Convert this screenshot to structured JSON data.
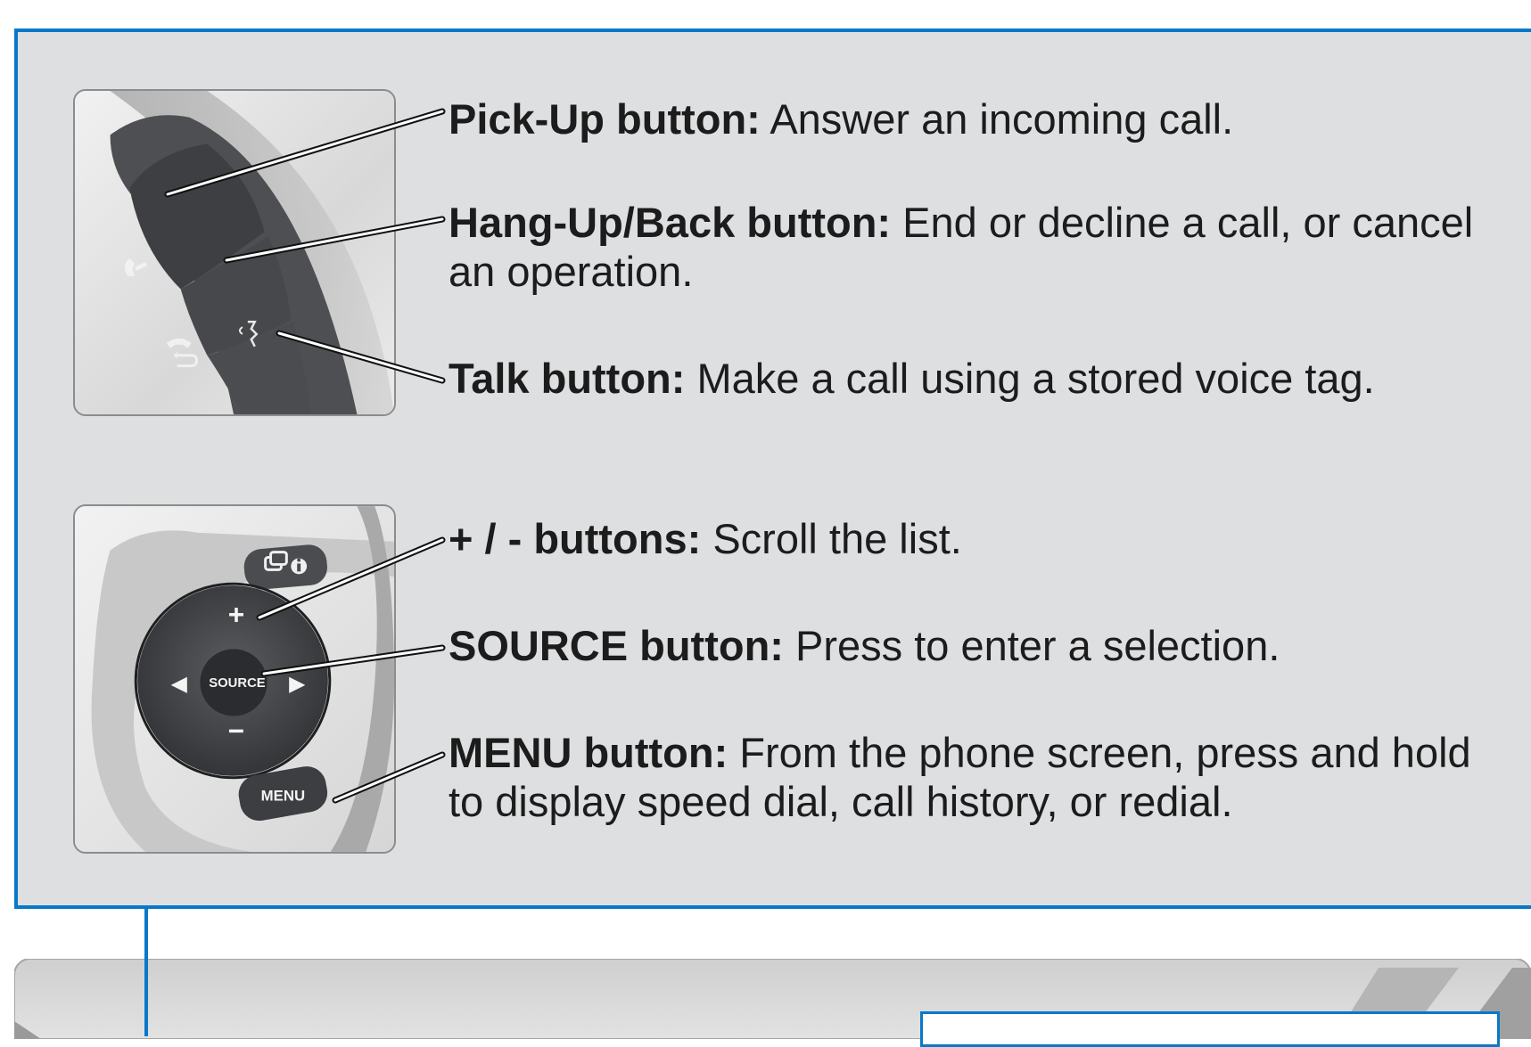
{
  "colors": {
    "frame_blue": "#0a78c8",
    "panel_bg": "#dedfe1",
    "text": "#1c1c1c"
  },
  "descriptions": {
    "pickup": {
      "label": "Pick-Up button:",
      "text": "Answer an incoming call."
    },
    "hangup": {
      "label": "Hang-Up/Back button:",
      "text": "End or decline a call, or cancel an operation."
    },
    "talk": {
      "label": "Talk button:",
      "text": "Make a call using a stored voice tag."
    },
    "plusminus": {
      "label": "+ / - buttons:",
      "text": "Scroll the list."
    },
    "source": {
      "label": "SOURCE button:",
      "text": "Press to enter a selection."
    },
    "menu": {
      "label": "MENU button:",
      "text": "From the phone screen, press and hold to display speed dial, call history, or redial."
    }
  },
  "controls": {
    "plus": "+",
    "minus": "−",
    "left": "◀",
    "right": "▶",
    "source": "SOURCE",
    "menu": "MENU"
  },
  "icons": [
    "phone-pickup-icon",
    "phone-hangup-icon",
    "back-arrow-icon",
    "voice-talk-icon",
    "display-info-icon"
  ]
}
